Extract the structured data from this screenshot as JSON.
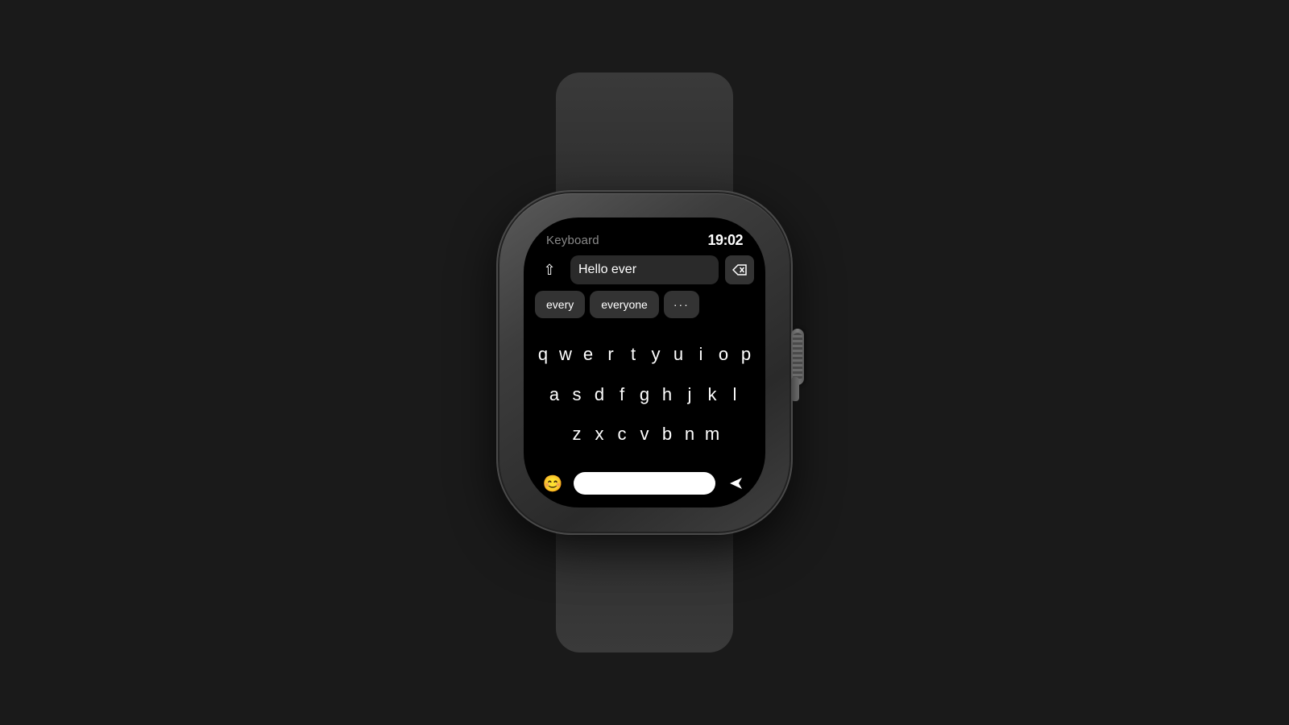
{
  "background": {
    "color": "#1a1a1a"
  },
  "watch": {
    "status_bar": {
      "title": "Keyboard",
      "time": "19:02"
    },
    "input": {
      "text": "Hello ever",
      "shift_icon": "⇧",
      "backspace_icon": "⌫"
    },
    "autocomplete": {
      "suggestions": [
        "every",
        "everyone",
        "•••"
      ]
    },
    "keyboard": {
      "row1": [
        "q",
        "w",
        "e",
        "r",
        "t",
        "y",
        "u",
        "i",
        "o",
        "p"
      ],
      "row2": [
        "a",
        "s",
        "d",
        "f",
        "g",
        "h",
        "j",
        "k",
        "l"
      ],
      "row3": [
        "z",
        "x",
        "c",
        "v",
        "b",
        "n",
        "m"
      ]
    },
    "bottom": {
      "emoji_label": "😊",
      "send_icon": "➤"
    }
  }
}
